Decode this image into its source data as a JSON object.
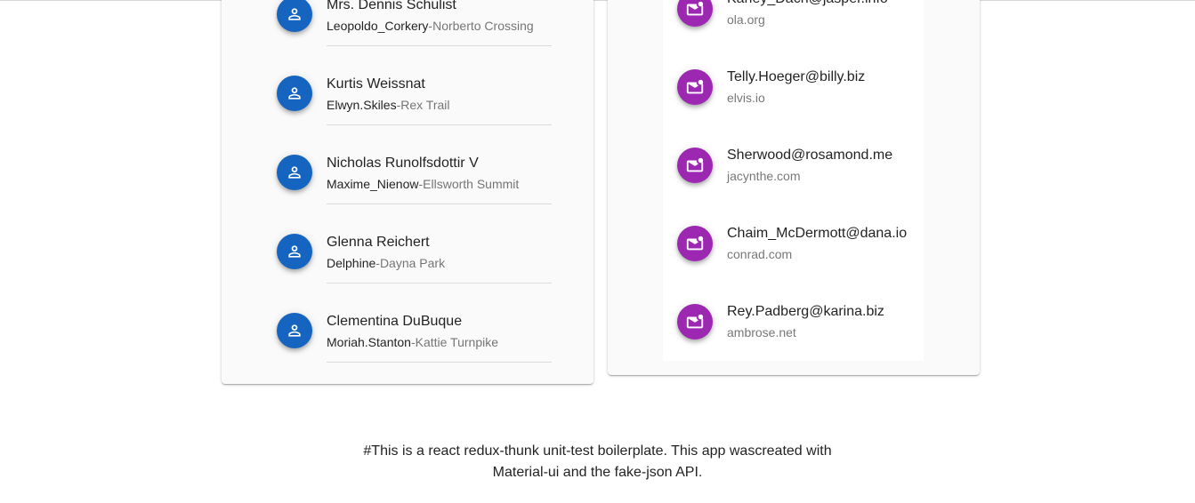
{
  "users": [
    {
      "name": "Mrs. Dennis Schulist",
      "username": "Leopoldo_Corkery",
      "street": "Norberto Crossing"
    },
    {
      "name": "Kurtis Weissnat",
      "username": "Elwyn.Skiles",
      "street": "Rex Trail"
    },
    {
      "name": "Nicholas Runolfsdottir V",
      "username": "Maxime_Nienow",
      "street": "Ellsworth Summit"
    },
    {
      "name": "Glenna Reichert",
      "username": "Delphine",
      "street": "Dayna Park"
    },
    {
      "name": "Clementina DuBuque",
      "username": "Moriah.Stanton",
      "street": "Kattie Turnpike"
    }
  ],
  "emails": [
    {
      "email": "Karley_Dach@jasper.info",
      "website": "ola.org"
    },
    {
      "email": "Telly.Hoeger@billy.biz",
      "website": "elvis.io"
    },
    {
      "email": "Sherwood@rosamond.me",
      "website": "jacynthe.com"
    },
    {
      "email": "Chaim_McDermott@dana.io",
      "website": "conrad.com"
    },
    {
      "email": "Rey.Padberg@karina.biz",
      "website": "ambrose.net"
    }
  ],
  "separator": "-",
  "icons": {
    "user": "person-icon",
    "email": "mail-icon"
  },
  "colors": {
    "user_avatar": "#1565c0",
    "email_avatar": "#9c27b0"
  },
  "footer": {
    "line1": "#This is a react redux-thunk unit-test boilerplate. This app wascreated with",
    "line2": "Material-ui and the fake-json API."
  }
}
